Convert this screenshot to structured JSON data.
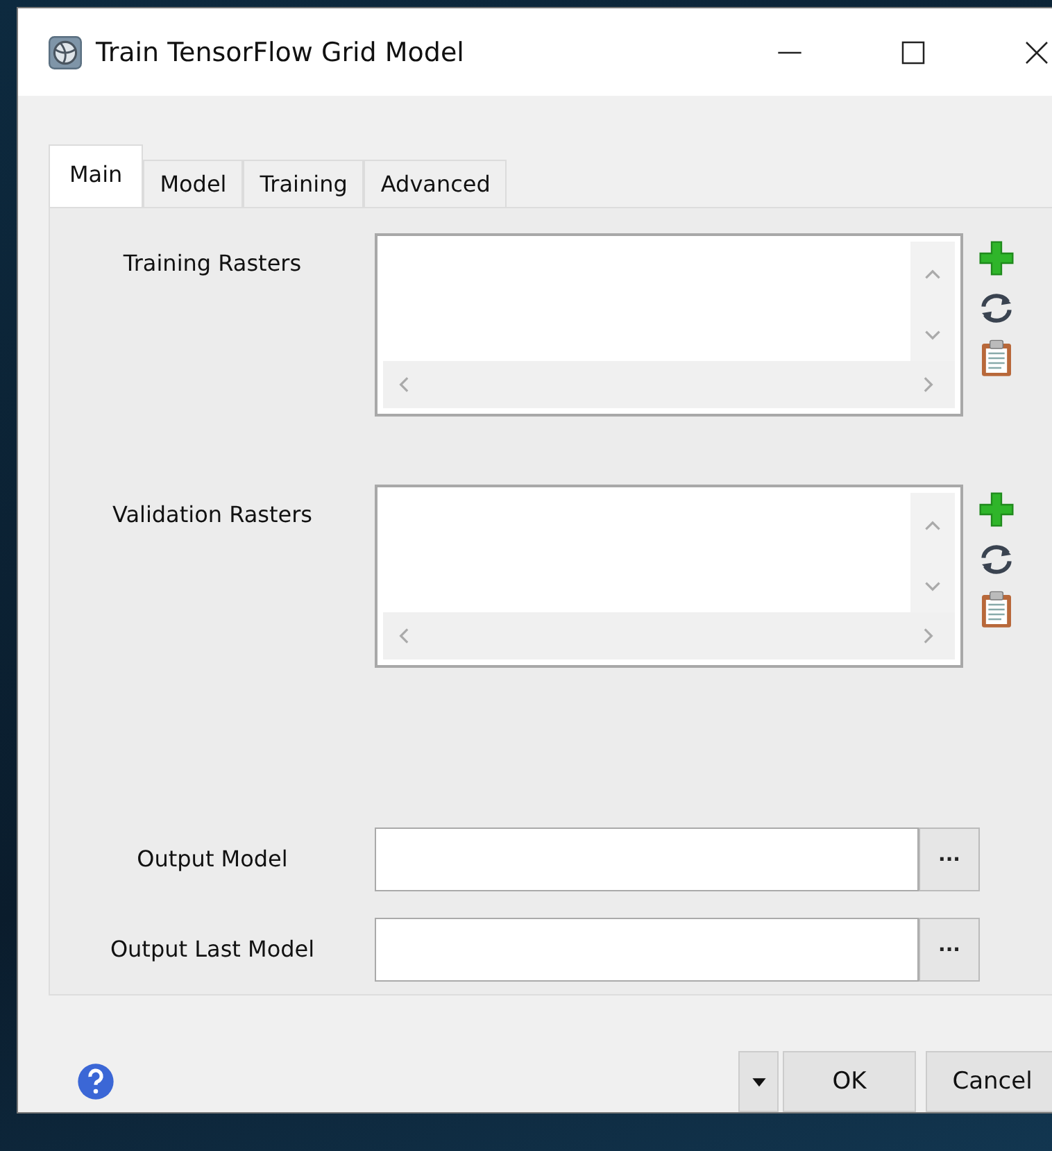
{
  "window": {
    "title": "Train TensorFlow Grid Model"
  },
  "tabs": [
    {
      "label": "Main",
      "selected": true
    },
    {
      "label": "Model",
      "selected": false
    },
    {
      "label": "Training",
      "selected": false
    },
    {
      "label": "Advanced",
      "selected": false
    }
  ],
  "list_fields": [
    {
      "label": "Training Rasters"
    },
    {
      "label": "Validation Rasters"
    }
  ],
  "file_fields": [
    {
      "label": "Output Model",
      "browse": "..."
    },
    {
      "label": "Output Last Model",
      "browse": "..."
    }
  ],
  "buttons": [
    {
      "label": "OK"
    },
    {
      "label": "Cancel"
    }
  ]
}
